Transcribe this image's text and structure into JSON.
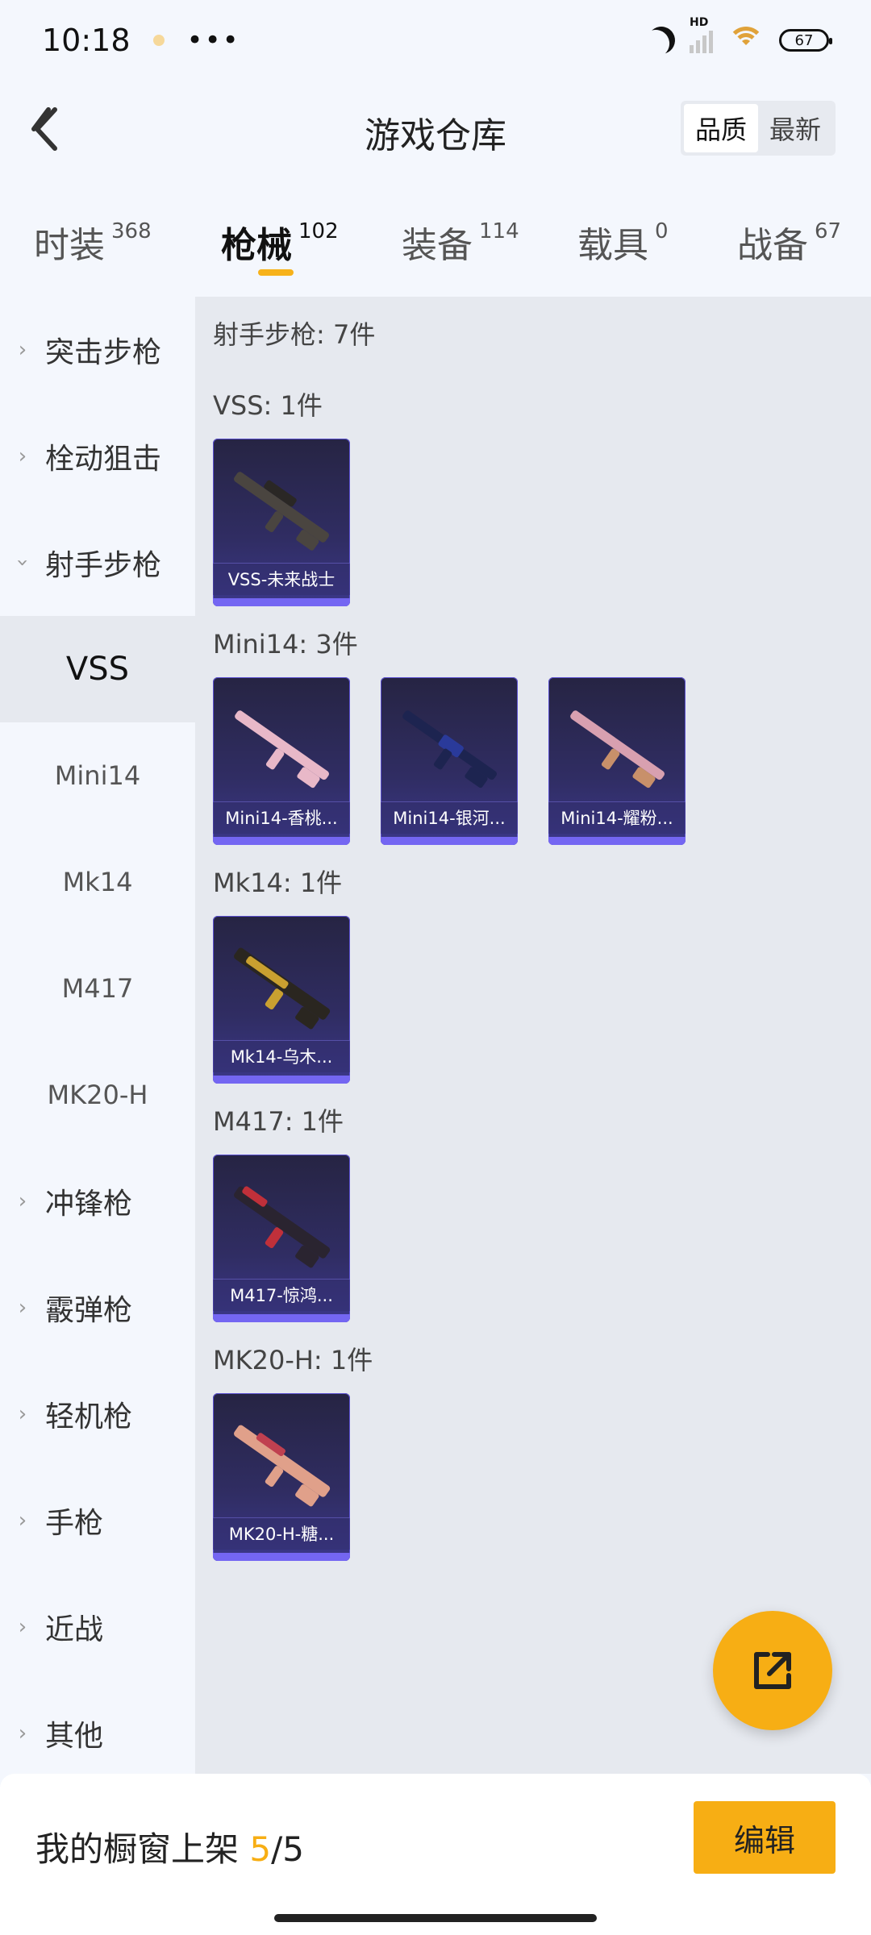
{
  "status_bar": {
    "time": "10:18",
    "more": "•••",
    "hd": "HD",
    "battery": "67"
  },
  "header": {
    "title": "游戏仓库",
    "sort_options": [
      "品质",
      "最新"
    ],
    "active_sort": "品质"
  },
  "tabs": [
    {
      "label": "时装",
      "count": "368"
    },
    {
      "label": "枪械",
      "count": "102",
      "active": true
    },
    {
      "label": "装备",
      "count": "114"
    },
    {
      "label": "载具",
      "count": "0"
    },
    {
      "label": "战备",
      "count": "67"
    }
  ],
  "sidebar": {
    "categories": [
      {
        "label": "突击步枪",
        "expanded": false
      },
      {
        "label": "栓动狙击",
        "expanded": false
      },
      {
        "label": "射手步枪",
        "expanded": true
      }
    ],
    "sub_items": [
      "VSS",
      "Mini14",
      "Mk14",
      "M417",
      "MK20-H"
    ],
    "active_sub": "VSS",
    "more_categories": [
      "冲锋枪",
      "霰弹枪",
      "轻机枪",
      "手枪",
      "近战",
      "其他"
    ]
  },
  "content": {
    "summary": "射手步枪: 7件",
    "groups": [
      {
        "title": "VSS: 1件",
        "items": [
          "VSS-未来战士"
        ]
      },
      {
        "title": "Mini14: 3件",
        "items": [
          "Mini14-香桃...",
          "Mini14-银河...",
          "Mini14-耀粉..."
        ]
      },
      {
        "title": "Mk14: 1件",
        "items": [
          "Mk14-乌木..."
        ]
      },
      {
        "title": "M417: 1件",
        "items": [
          "M417-惊鸿..."
        ]
      },
      {
        "title": "MK20-H: 1件",
        "items": [
          "MK20-H-糖..."
        ]
      }
    ],
    "gun_colors": [
      "#4a4540",
      "#e8b8c8",
      "#2a3a7a",
      "#d8a0b0",
      "#c9a030",
      "#c0303a",
      "#e0a08a"
    ]
  },
  "bottom_bar": {
    "label": "我的橱窗上架",
    "count_current": "5",
    "count_total": "/5",
    "edit_label": "编辑"
  },
  "colors": {
    "accent": "#f7ae14",
    "card_bg": "#302d63",
    "card_stripe": "#7466f2"
  }
}
